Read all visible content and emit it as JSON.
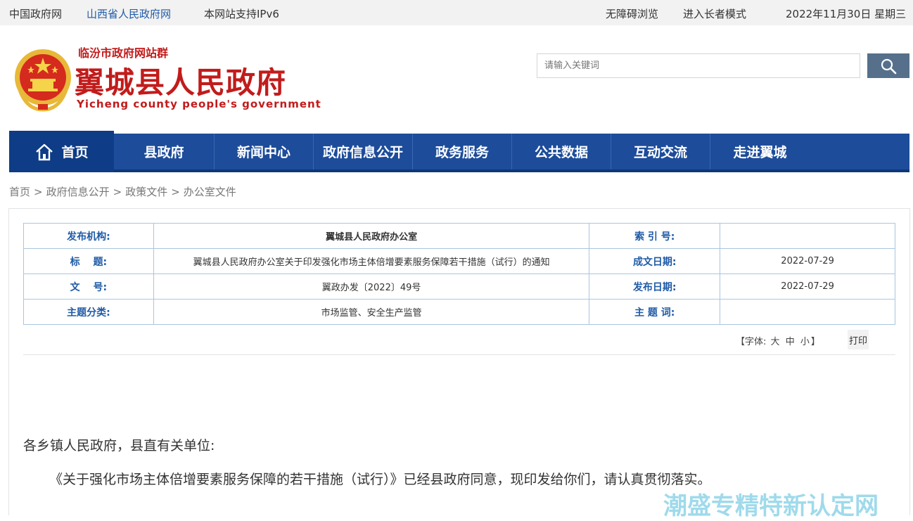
{
  "topbar": {
    "link1": "中国政府网",
    "link2": "山西省人民政府网",
    "ipv6": "本网站支持IPv6",
    "accessibility": "无障碍浏览",
    "elder_mode": "进入长者模式",
    "date": "2022年11月30日 星期三"
  },
  "header": {
    "site_group": "临汾市政府网站群",
    "title": "翼城县人民政府",
    "subtitle_en": "Yicheng county people's government",
    "search_placeholder": "请输入关键词"
  },
  "nav": {
    "home": "首页",
    "items": [
      "县政府",
      "新闻中心",
      "政府信息公开",
      "政务服务",
      "公共数据",
      "互动交流",
      "走进翼城"
    ]
  },
  "breadcrumb": [
    "首页",
    "政府信息公开",
    "政策文件",
    "办公室文件"
  ],
  "breadcrumb_sep": ">",
  "meta": {
    "publisher_label": "发布机构:",
    "publisher": "翼城县人民政府办公室",
    "index_label": "索 引 号:",
    "index": "",
    "title_label": "标　 题:",
    "title": "翼城县人民政府办公室关于印发强化市场主体倍增要素服务保障若干措施（试行）的通知",
    "written_label": "成文日期:",
    "written_date": "2022-07-29",
    "doc_no_label": "文　 号:",
    "doc_no": "翼政办发〔2022〕49号",
    "publish_label": "发布日期:",
    "publish_date": "2022-07-29",
    "category_label": "主题分类:",
    "category": "市场监管、安全生产监管",
    "keywords_label": "主 题 词:",
    "keywords": ""
  },
  "font_size": {
    "prefix": "【字体:",
    "large": "大",
    "medium": "中",
    "small": "小",
    "suffix": "】"
  },
  "print_label": "打印",
  "article": {
    "salutation": "各乡镇人民政府，县直有关单位:",
    "paragraph1": "《关于强化市场主体倍增要素服务保障的若干措施（试行）》已经县政府同意，现印发给你们，请认真贯彻落实。"
  },
  "watermark": "潮盛专精特新认定网",
  "colors": {
    "nav_bg": "#1d4c9a",
    "brand_red": "#c21b1b",
    "link_blue": "#1f5aa6"
  }
}
